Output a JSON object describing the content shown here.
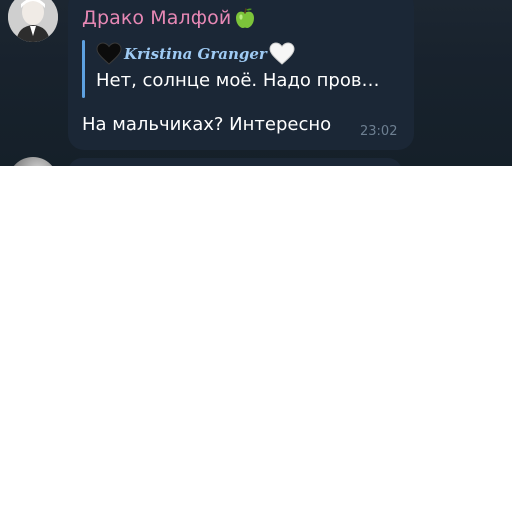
{
  "message": {
    "sender_name": "Драко Малфой",
    "sender_emoji_icon": "green-apple-icon",
    "reply": {
      "author_name": "Kristina Granger",
      "left_icon": "black-heart-icon",
      "right_icon": "white-heart-icon",
      "text": "Нет, солнце моё. Надо пров…"
    },
    "text": "На мальчиках? Интересно",
    "time": "23:02"
  },
  "colors": {
    "chat_background": "#18222d",
    "bubble": "#1b2736",
    "sender_name": "#e788b5",
    "reply_accent": "#5ea1e0",
    "reply_author": "#9fcbf4",
    "message_text": "#ffffff",
    "time_text": "#6d7f91"
  }
}
